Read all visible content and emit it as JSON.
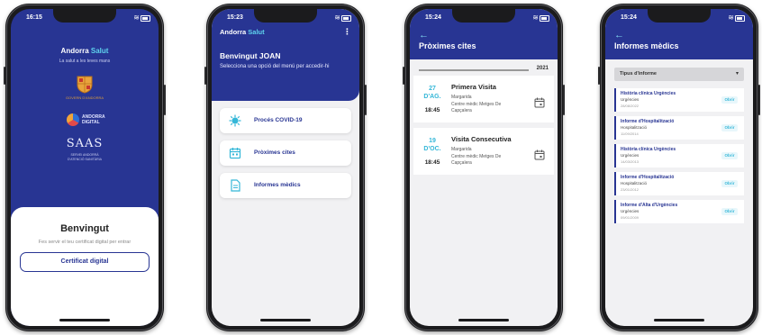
{
  "status": {
    "time_1": "16:15",
    "time_2": "15:23",
    "time_3": "15:24",
    "time_4": "15:24",
    "wifi": "≋"
  },
  "login": {
    "brand_a": "Andorra ",
    "brand_b": "Salut",
    "tagline": "La salut a les teves mans",
    "gov_caption": "GOVERN D'ANDORRA",
    "andorra_line1": "ANDORRA",
    "andorra_line2": "DIGITAL",
    "sas": "SAAS",
    "sas_sub1": "SERVEI ANDORRÀ",
    "sas_sub2": "D'ATENCIÓ SANITÀRIA",
    "welcome": "Benvingut",
    "hint": "Fes servir el teu certificat digital per entrar",
    "cert_button": "Certificat digital"
  },
  "home": {
    "brand_a": "Andorra ",
    "brand_b": "Salut",
    "menu_icon": "⋮",
    "greeting": "Benvingut JOAN",
    "prompt": "Selecciona una opció del menú per accedir-hi",
    "items": [
      {
        "label": "Procés COVID-19",
        "icon": "virus-icon"
      },
      {
        "label": "Pròximes cites",
        "icon": "calendar-icon"
      },
      {
        "label": "Informes mèdics",
        "icon": "document-icon"
      }
    ]
  },
  "appointments": {
    "back": "←",
    "title": "Pròximes cites",
    "year": "2021",
    "items": [
      {
        "day": "27",
        "month": "D'AG.",
        "hour": "18:45",
        "title": "Primera Visita",
        "person": "Margarida",
        "place": "Centre mèdic Metges De Capçalera"
      },
      {
        "day": "19",
        "month": "D'OC.",
        "hour": "18:45",
        "title": "Visita Consecutiva",
        "person": "Margarida",
        "place": "Centre mèdic Metges De Capçalera"
      }
    ]
  },
  "reports": {
    "back": "←",
    "title": "Informes mèdics",
    "filter_value": "Tipus d'informe",
    "chevron": "▾",
    "items": [
      {
        "title": "Història clínica Urgències",
        "service": "Urgències",
        "date": "28/08/2022",
        "action": "Obrir"
      },
      {
        "title": "Informe d'Hospitalització",
        "service": "Hospitalització",
        "date": "11/09/2014",
        "action": "Obrir"
      },
      {
        "title": "Història clínica Urgències",
        "service": "Urgències",
        "date": "14/03/2013",
        "action": "Obrir"
      },
      {
        "title": "Informe d'Hospitalització",
        "service": "Hospitalització",
        "date": "23/01/2012",
        "action": "Obrir"
      },
      {
        "title": "Informe d'Alta d'Urgències",
        "service": "Urgències",
        "date": "09/01/2009",
        "action": "Obrir"
      }
    ]
  },
  "colors": {
    "primary": "#283593",
    "accent": "#35b7d8"
  }
}
